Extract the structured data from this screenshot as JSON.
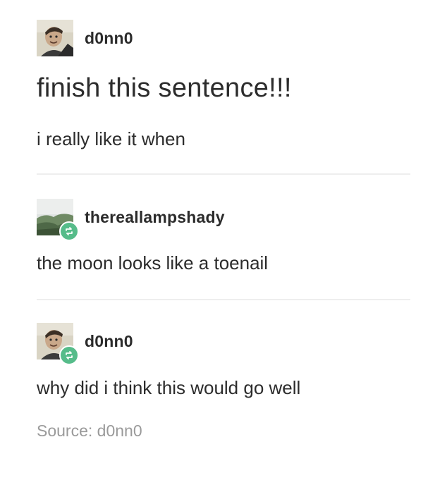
{
  "posts": [
    {
      "username": "d0nn0",
      "title": "finish this sentence!!!",
      "body": "i really like it when",
      "avatar_icon": "person-avatar-icon"
    },
    {
      "username": "thereallampshady",
      "body": "the moon looks like a toenail",
      "avatar_icon": "landscape-avatar-icon",
      "reblog_icon": "reblog-icon"
    },
    {
      "username": "d0nn0",
      "body": "why did i think this would go well",
      "avatar_icon": "person-avatar-icon",
      "reblog_icon": "reblog-icon"
    }
  ],
  "source": {
    "text": "Source: d0nn0"
  },
  "colors": {
    "text": "#2c2c2c",
    "source": "#9a9a9a",
    "reblog_badge": "#56bc8a",
    "divider": "#eeeeee"
  }
}
